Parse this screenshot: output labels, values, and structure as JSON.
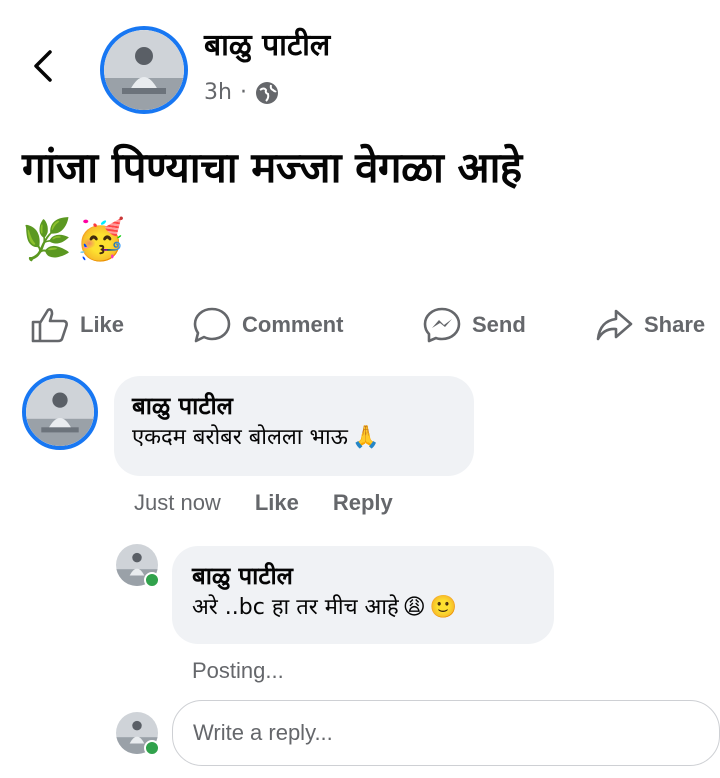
{
  "post": {
    "author": "बाळु पाटील",
    "time": "3h",
    "separator": "·",
    "text": "गांजा पिण्याचा मज्जा वेगळा आहे",
    "emojis": [
      "🌿",
      "🥳"
    ]
  },
  "actions": {
    "like": "Like",
    "comment": "Comment",
    "send": "Send",
    "share": "Share"
  },
  "comment": {
    "author": "बाळु पाटील",
    "text": "एकदम बरोबर बोलला भाऊ",
    "emoji": "🙏",
    "time": "Just now",
    "like": "Like",
    "reply": "Reply"
  },
  "reply": {
    "author": "बाळु पाटील",
    "text": "अरे ..bc हा तर मीच आहे",
    "emojis": [
      "😩",
      "🙂"
    ],
    "status": "Posting..."
  },
  "reply_input": {
    "placeholder": "Write a reply..."
  },
  "colors": {
    "accent": "#1877f2",
    "bubble": "#f0f2f5",
    "muted": "#65676b",
    "online": "#31a24c"
  }
}
